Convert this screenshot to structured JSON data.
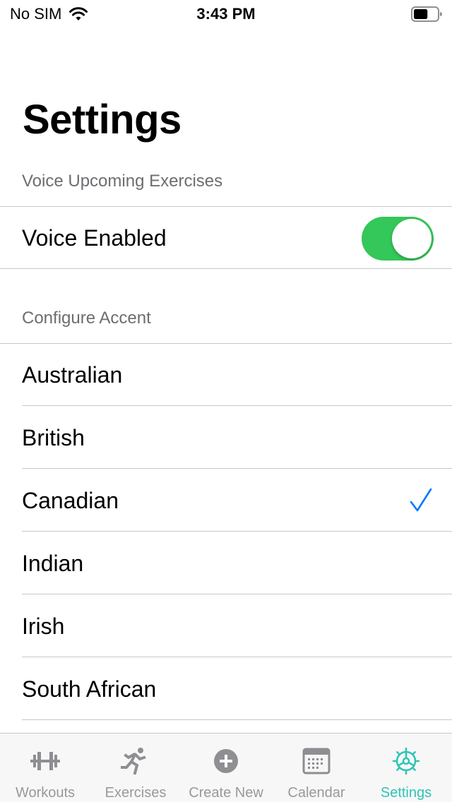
{
  "status_bar": {
    "carrier": "No SIM",
    "time": "3:43 PM",
    "battery_level": 0.6
  },
  "title": "Settings",
  "voice_section": {
    "header": "Voice Upcoming Exercises",
    "toggle_label": "Voice Enabled",
    "toggle_on": true
  },
  "accent_section": {
    "header": "Configure Accent",
    "options": [
      {
        "label": "Australian",
        "selected": false
      },
      {
        "label": "British",
        "selected": false
      },
      {
        "label": "Canadian",
        "selected": true
      },
      {
        "label": "Indian",
        "selected": false
      },
      {
        "label": "Irish",
        "selected": false
      },
      {
        "label": "South African",
        "selected": false
      }
    ]
  },
  "tab_bar": {
    "tabs": [
      {
        "label": "Workouts",
        "icon": "dumbbell-icon",
        "active": false
      },
      {
        "label": "Exercises",
        "icon": "runner-icon",
        "active": false
      },
      {
        "label": "Create New",
        "icon": "plus-circle-icon",
        "active": false
      },
      {
        "label": "Calendar",
        "icon": "calendar-icon",
        "active": false
      },
      {
        "label": "Settings",
        "icon": "gear-icon",
        "active": true
      }
    ]
  },
  "colors": {
    "accent": "#2ec4b6",
    "toggle_on": "#34c759",
    "checkmark": "#007aff",
    "inactive_tab": "#999999",
    "section_header": "#6d6d72"
  }
}
